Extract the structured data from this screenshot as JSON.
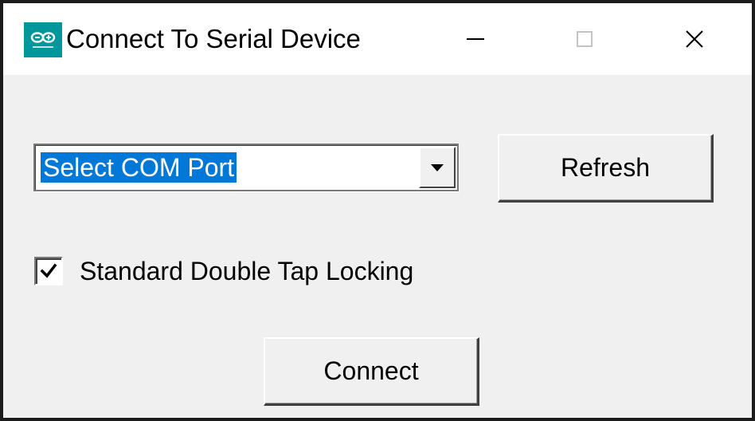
{
  "window": {
    "title": "Connect To Serial Device",
    "app_icon": "arduino-logo-icon",
    "controls": {
      "minimize": "minimize-icon",
      "maximize": "maximize-icon",
      "close": "close-icon"
    }
  },
  "port_select": {
    "value": "Select COM Port",
    "dropdown_icon": "chevron-down-icon"
  },
  "refresh_button": {
    "label": "Refresh"
  },
  "double_tap_option": {
    "label": "Standard Double Tap Locking",
    "checked": true
  },
  "connect_button": {
    "label": "Connect"
  },
  "colors": {
    "accent": "#00979c",
    "selection": "#0078d7",
    "dialog_bg": "#f0f0f0",
    "titlebar_bg": "#ffffff"
  }
}
